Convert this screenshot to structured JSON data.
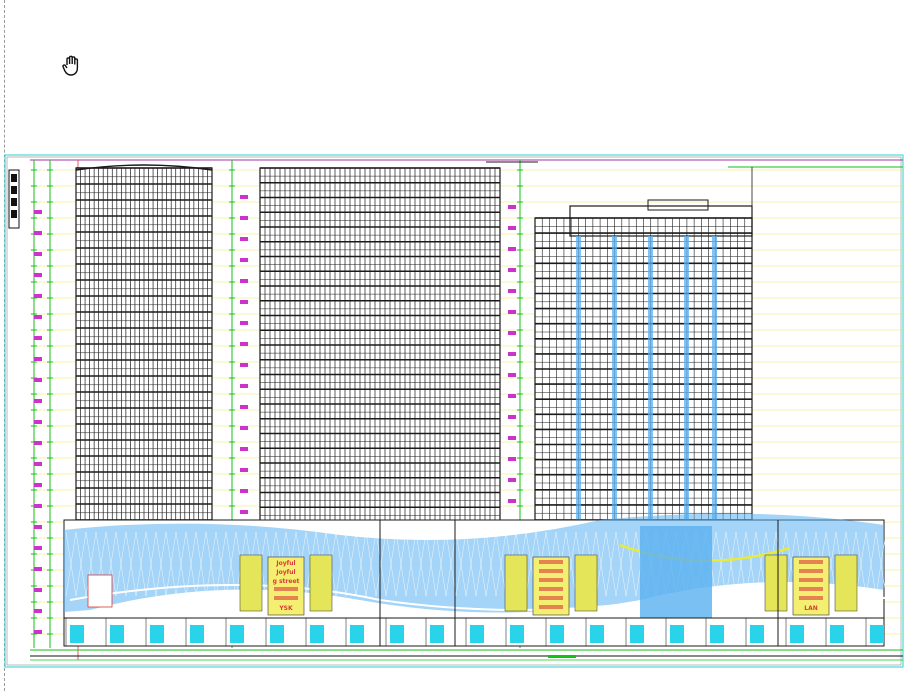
{
  "viewer": {
    "tool_icon": "pan-hand-icon"
  },
  "colors": {
    "background": "#ffffff",
    "frame": "#7a7a7a",
    "grid_yellow": "#e9e65a",
    "dimension_green": "#16c116",
    "tag_magenta": "#cc33cc",
    "podium_blue": "#5ab0f0",
    "podium_cyan": "#29d3ea",
    "tower_ink": "#1a1a1a",
    "accent_red": "#d93a3a",
    "border_cyan": "#2bd2d6"
  },
  "drawing": {
    "towers": [
      {
        "name": "tower-left",
        "floors": 22
      },
      {
        "name": "tower-center",
        "floors": 24
      },
      {
        "name": "tower-right",
        "floors": 20
      }
    ],
    "signage": [
      {
        "name": "sign-left",
        "lines": [
          "Joyful",
          "Joyful",
          "g street",
          "",
          "",
          "YSK"
        ]
      },
      {
        "name": "sign-center",
        "lines": [
          "",
          "",
          "",
          "",
          "",
          ""
        ]
      },
      {
        "name": "sign-right",
        "lines": [
          "",
          "",
          "",
          "",
          "",
          "LAN"
        ]
      }
    ],
    "footer_label": ""
  }
}
